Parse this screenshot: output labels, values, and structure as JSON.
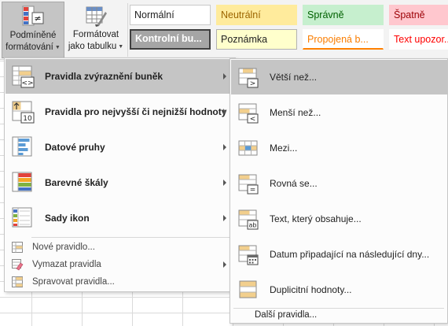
{
  "ribbon": {
    "conditional_formatting": {
      "line1": "Podmíněné",
      "line2": "formátování"
    },
    "format_as_table": {
      "line1": "Formátovat",
      "line2": "jako tabulku"
    },
    "cell_styles": [
      "Normální",
      "Neutrální",
      "Správně",
      "Špatně",
      "Kontrolní bu...",
      "Poznámka",
      "Propojená b...",
      "Text upozor..."
    ]
  },
  "menu": {
    "items": [
      {
        "label": "Pravidla zvýraznění buněk",
        "icon": "highlight-rules-icon"
      },
      {
        "label": "Pravidla pro nejvyšší či nejnižší hodnoty",
        "icon": "top-bottom-rules-icon"
      },
      {
        "label": "Datové pruhy",
        "icon": "data-bars-icon"
      },
      {
        "label": "Barevné škály",
        "icon": "color-scales-icon"
      },
      {
        "label": "Sady ikon",
        "icon": "icon-sets-icon"
      }
    ],
    "small_items": [
      {
        "label": "Nové pravidlo...",
        "icon": "new-rule-icon"
      },
      {
        "label": "Vymazat pravidla",
        "icon": "clear-rules-icon"
      },
      {
        "label": "Spravovat pravidla...",
        "icon": "manage-rules-icon"
      }
    ]
  },
  "submenu": {
    "items": [
      {
        "label": "Větší než...",
        "icon": "greater-than-icon"
      },
      {
        "label": "Menší než...",
        "icon": "less-than-icon"
      },
      {
        "label": "Mezi...",
        "icon": "between-icon"
      },
      {
        "label": "Rovná se...",
        "icon": "equal-to-icon"
      },
      {
        "label": "Text, který obsahuje...",
        "icon": "text-contains-icon"
      },
      {
        "label": "Datum připadající na následující dny...",
        "icon": "date-occurring-icon"
      },
      {
        "label": "Duplicitní hodnoty...",
        "icon": "duplicate-values-icon"
      }
    ],
    "more": "Další pravidla..."
  },
  "colors": {
    "highlight": "#c5c5c5",
    "cell_fill": "#f2cf8d",
    "data_bar": "#5b9bd5"
  }
}
